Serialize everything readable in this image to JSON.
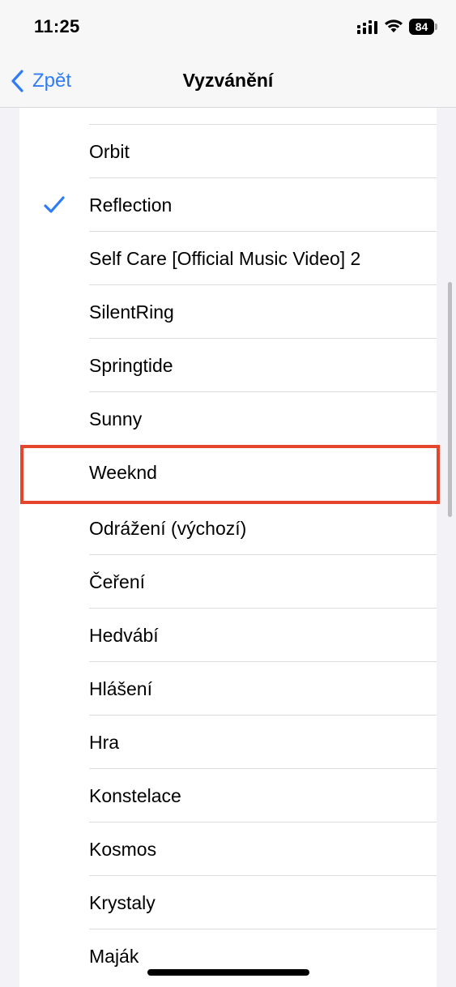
{
  "status_bar": {
    "time": "11:25",
    "battery": "84",
    "icons": [
      "signal-icon",
      "wifi-icon",
      "battery-icon"
    ]
  },
  "nav": {
    "back_label": "Zpět",
    "title": "Vyzvánění"
  },
  "list": {
    "items": [
      {
        "label": "Orbit",
        "selected": false
      },
      {
        "label": "Reflection",
        "selected": true
      },
      {
        "label": "Self Care [Official Music Video] 2",
        "selected": false
      },
      {
        "label": "SilentRing",
        "selected": false
      },
      {
        "label": "Springtide",
        "selected": false
      },
      {
        "label": "Sunny",
        "selected": false
      },
      {
        "label": "Weeknd",
        "selected": false,
        "highlighted": true
      },
      {
        "label": "Odrážení (výchozí)",
        "selected": false
      },
      {
        "label": "Čeření",
        "selected": false
      },
      {
        "label": "Hedvábí",
        "selected": false
      },
      {
        "label": "Hlášení",
        "selected": false
      },
      {
        "label": "Hra",
        "selected": false
      },
      {
        "label": "Konstelace",
        "selected": false
      },
      {
        "label": "Kosmos",
        "selected": false
      },
      {
        "label": "Krystaly",
        "selected": false
      },
      {
        "label": "Maják",
        "selected": false
      }
    ]
  },
  "colors": {
    "accent": "#2f7cf6",
    "highlight": "#e4452c",
    "background": "#f2f2f7"
  }
}
